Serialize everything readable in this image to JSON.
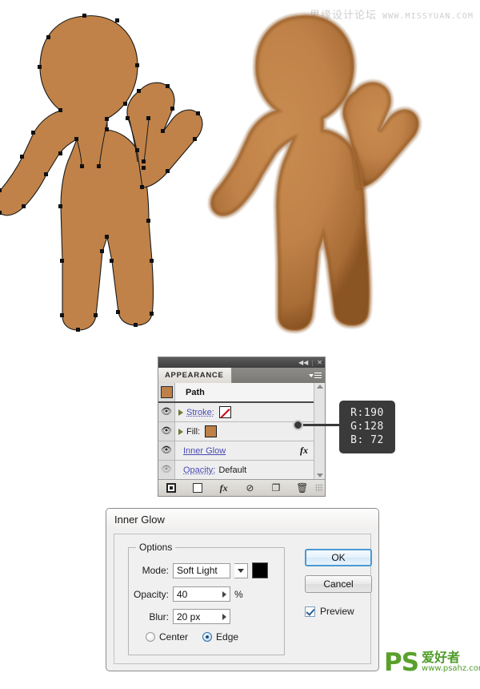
{
  "watermark": {
    "cn_text": "思缘设计论坛",
    "url_text": "WWW.MISSYUAN.COM"
  },
  "figures": {
    "left_figure_label": "gingerbread-outline-with-anchor-points",
    "right_figure_label": "gingerbread-with-inner-glow",
    "fill_color": "#c08248",
    "stroke_color": "#1a1a1a",
    "glow_edge_color": "#8a5423"
  },
  "appearance_panel": {
    "titlebar": {
      "collapse_label": "◀◀",
      "close_label": "✕"
    },
    "tab_label": "APPEARANCE",
    "rows": [
      {
        "id": "path",
        "type": "title",
        "label": "Path",
        "swatch_color": "#be8048"
      },
      {
        "id": "stroke",
        "type": "attribute",
        "label": "Stroke:",
        "swatch": "none",
        "swatch_color": "#ffffff",
        "visible": true
      },
      {
        "id": "fill",
        "type": "attribute",
        "label": "Fill:",
        "swatch": "color",
        "swatch_color": "#be8048",
        "visible": true
      },
      {
        "id": "inner-glow",
        "type": "effect",
        "label": "Inner Glow",
        "fx_label": "fx",
        "visible": true
      },
      {
        "id": "opacity",
        "type": "attribute",
        "label": "Opacity:",
        "value": "Default",
        "visible": true
      }
    ],
    "footer_buttons": [
      {
        "id": "new-art-has-basic-appearance",
        "glyph": ""
      },
      {
        "id": "clear-appearance",
        "glyph": ""
      },
      {
        "id": "add-new-effect",
        "glyph": "fx"
      },
      {
        "id": "reduce-to-basic-appearance",
        "glyph": "⊘"
      },
      {
        "id": "duplicate-selected-item",
        "glyph": "❐"
      },
      {
        "id": "delete-selected-item",
        "glyph": "🗑"
      }
    ]
  },
  "rgb_callout": {
    "r_line": "R:190",
    "g_line": "G:128",
    "b_line": "B: 72",
    "color_hex": "#be8048"
  },
  "inner_glow_dialog": {
    "title": "Inner Glow",
    "options_legend": "Options",
    "mode_label": "Mode:",
    "mode_value": "Soft Light",
    "glow_color": "#000000",
    "opacity_label": "Opacity:",
    "opacity_value": "40",
    "opacity_unit": "%",
    "blur_label": "Blur:",
    "blur_value": "20 px",
    "source_center_label": "Center",
    "source_edge_label": "Edge",
    "source_selected": "Edge",
    "ok_label": "OK",
    "cancel_label": "Cancel",
    "preview_label": "Preview",
    "preview_checked": true
  },
  "ps_logo": {
    "mark": "PS",
    "cn_text": "爱好者",
    "url_text": "www.psahz.com",
    "color": "#4f9c2a"
  }
}
